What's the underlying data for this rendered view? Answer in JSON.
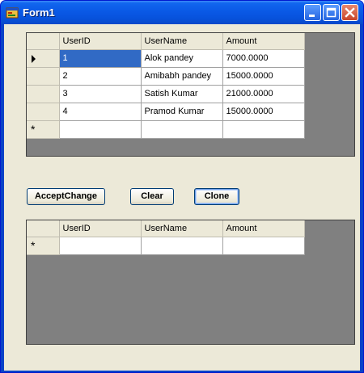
{
  "window": {
    "title": "Form1"
  },
  "grid1": {
    "columns": [
      "UserID",
      "UserName",
      "Amount"
    ],
    "rows": [
      [
        "1",
        "Alok pandey",
        "7000.0000"
      ],
      [
        "2",
        "Amibabh pandey",
        "15000.0000"
      ],
      [
        "3",
        "Satish Kumar",
        "21000.0000"
      ],
      [
        "4",
        "Pramod Kumar",
        "15000.0000"
      ]
    ],
    "new_row_marker": "*"
  },
  "buttons": {
    "accept_label": "AcceptChange",
    "clear_label": "Clear",
    "clone_label": "Clone"
  },
  "grid2": {
    "columns": [
      "UserID",
      "UserName",
      "Amount"
    ],
    "new_row_marker": "*"
  },
  "colors": {
    "titlebar": "#0a59e6",
    "selection": "#316ac5",
    "grid_background": "#808080",
    "form_background": "#ece9d8"
  }
}
